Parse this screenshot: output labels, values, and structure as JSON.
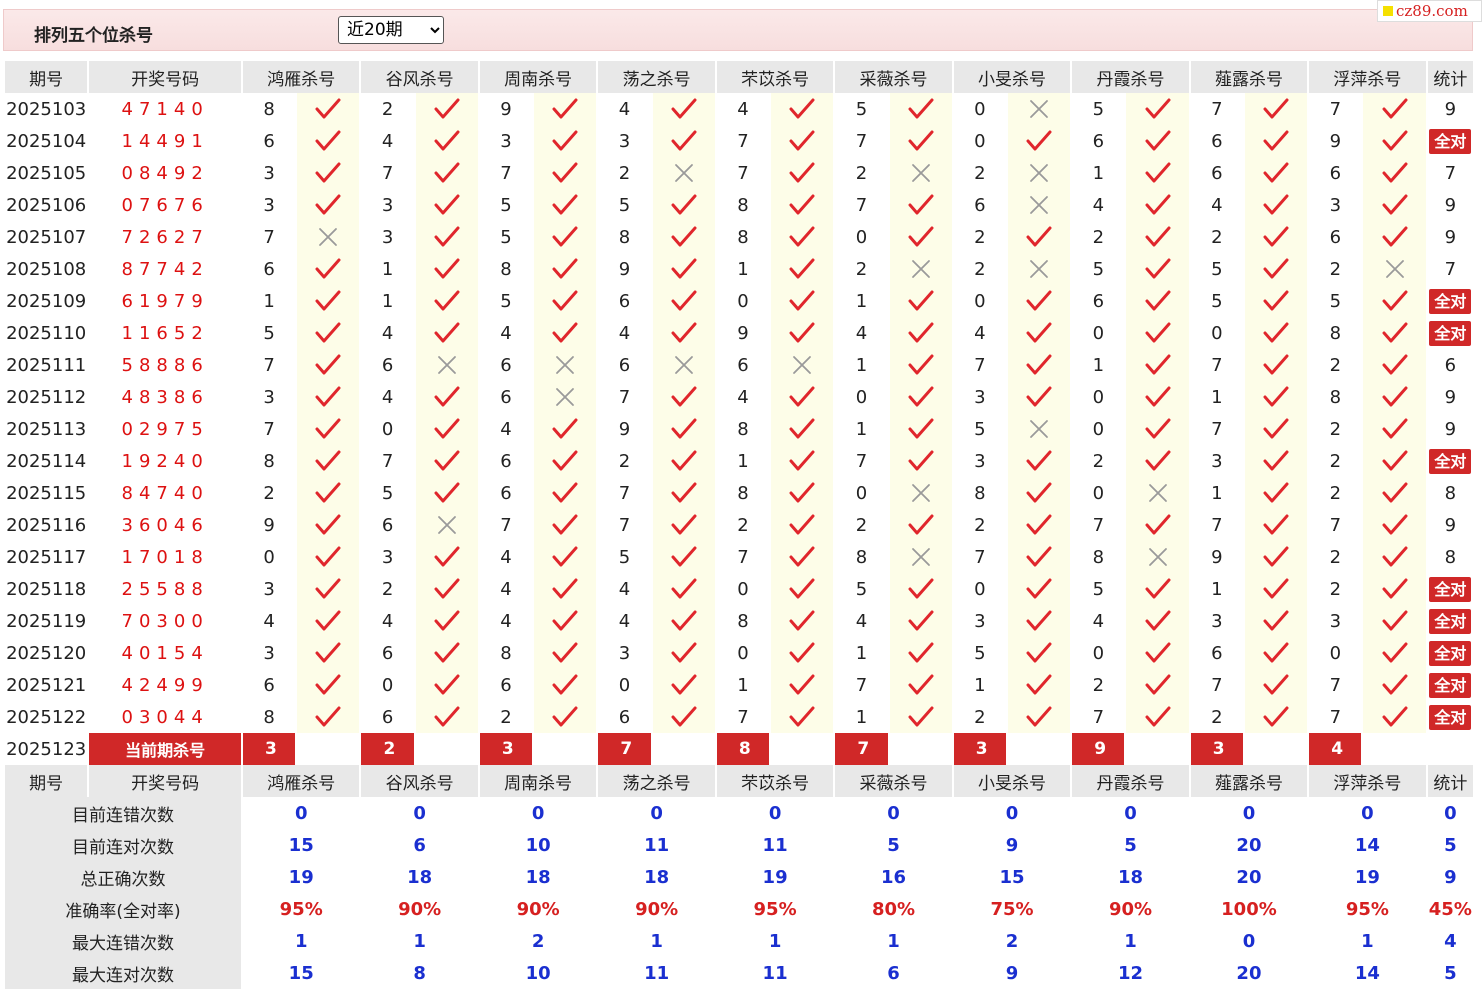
{
  "header": {
    "title": "排列五个位杀号",
    "range_select": "近20期",
    "range_options": [
      "近20期"
    ],
    "brand": "cz89.com"
  },
  "columns": {
    "period": "期号",
    "draw": "开奖号码",
    "experts": [
      "鸿雁杀号",
      "谷风杀号",
      "周南杀号",
      "荡之杀号",
      "芣苡杀号",
      "采薇杀号",
      "小旻杀号",
      "丹霞杀号",
      "薤露杀号",
      "浮萍杀号"
    ],
    "stat": "统计"
  },
  "marks": {
    "right": "✓",
    "wrong": "✗"
  },
  "all_right_label": "全对",
  "rows": [
    {
      "period": "2025103",
      "draw": "47140",
      "kills": [
        8,
        2,
        9,
        4,
        4,
        5,
        0,
        5,
        7,
        7
      ],
      "ok": [
        1,
        1,
        1,
        1,
        1,
        1,
        0,
        1,
        1,
        1
      ],
      "stat": "9"
    },
    {
      "period": "2025104",
      "draw": "14491",
      "kills": [
        6,
        4,
        3,
        3,
        7,
        7,
        0,
        6,
        6,
        9
      ],
      "ok": [
        1,
        1,
        1,
        1,
        1,
        1,
        1,
        1,
        1,
        1
      ],
      "stat": "全对"
    },
    {
      "period": "2025105",
      "draw": "08492",
      "kills": [
        3,
        7,
        7,
        2,
        7,
        2,
        2,
        1,
        6,
        6
      ],
      "ok": [
        1,
        1,
        1,
        0,
        1,
        0,
        0,
        1,
        1,
        1
      ],
      "stat": "7"
    },
    {
      "period": "2025106",
      "draw": "07676",
      "kills": [
        3,
        3,
        5,
        5,
        8,
        7,
        6,
        4,
        4,
        3
      ],
      "ok": [
        1,
        1,
        1,
        1,
        1,
        1,
        0,
        1,
        1,
        1
      ],
      "stat": "9"
    },
    {
      "period": "2025107",
      "draw": "72627",
      "kills": [
        7,
        3,
        5,
        8,
        8,
        0,
        2,
        2,
        2,
        6
      ],
      "ok": [
        0,
        1,
        1,
        1,
        1,
        1,
        1,
        1,
        1,
        1
      ],
      "stat": "9"
    },
    {
      "period": "2025108",
      "draw": "87742",
      "kills": [
        6,
        1,
        8,
        9,
        1,
        2,
        2,
        5,
        5,
        2
      ],
      "ok": [
        1,
        1,
        1,
        1,
        1,
        0,
        0,
        1,
        1,
        0
      ],
      "stat": "7"
    },
    {
      "period": "2025109",
      "draw": "61979",
      "kills": [
        1,
        1,
        5,
        6,
        0,
        1,
        0,
        6,
        5,
        5
      ],
      "ok": [
        1,
        1,
        1,
        1,
        1,
        1,
        1,
        1,
        1,
        1
      ],
      "stat": "全对"
    },
    {
      "period": "2025110",
      "draw": "11652",
      "kills": [
        5,
        4,
        4,
        4,
        9,
        4,
        4,
        0,
        0,
        8
      ],
      "ok": [
        1,
        1,
        1,
        1,
        1,
        1,
        1,
        1,
        1,
        1
      ],
      "stat": "全对"
    },
    {
      "period": "2025111",
      "draw": "58886",
      "kills": [
        7,
        6,
        6,
        6,
        6,
        1,
        7,
        1,
        7,
        2
      ],
      "ok": [
        1,
        0,
        0,
        0,
        0,
        1,
        1,
        1,
        1,
        1
      ],
      "stat": "6"
    },
    {
      "period": "2025112",
      "draw": "48386",
      "kills": [
        3,
        4,
        6,
        7,
        4,
        0,
        3,
        0,
        1,
        8
      ],
      "ok": [
        1,
        1,
        0,
        1,
        1,
        1,
        1,
        1,
        1,
        1
      ],
      "stat": "9"
    },
    {
      "period": "2025113",
      "draw": "02975",
      "kills": [
        7,
        0,
        4,
        9,
        8,
        1,
        5,
        0,
        7,
        2
      ],
      "ok": [
        1,
        1,
        1,
        1,
        1,
        1,
        0,
        1,
        1,
        1
      ],
      "stat": "9"
    },
    {
      "period": "2025114",
      "draw": "19240",
      "kills": [
        8,
        7,
        6,
        2,
        1,
        7,
        3,
        2,
        3,
        2
      ],
      "ok": [
        1,
        1,
        1,
        1,
        1,
        1,
        1,
        1,
        1,
        1
      ],
      "stat": "全对"
    },
    {
      "period": "2025115",
      "draw": "84740",
      "kills": [
        2,
        5,
        6,
        7,
        8,
        0,
        8,
        0,
        1,
        2
      ],
      "ok": [
        1,
        1,
        1,
        1,
        1,
        0,
        1,
        0,
        1,
        1
      ],
      "stat": "8"
    },
    {
      "period": "2025116",
      "draw": "36046",
      "kills": [
        9,
        6,
        7,
        7,
        2,
        2,
        2,
        7,
        7,
        7
      ],
      "ok": [
        1,
        0,
        1,
        1,
        1,
        1,
        1,
        1,
        1,
        1
      ],
      "stat": "9"
    },
    {
      "period": "2025117",
      "draw": "17018",
      "kills": [
        0,
        3,
        4,
        5,
        7,
        8,
        7,
        8,
        9,
        2
      ],
      "ok": [
        1,
        1,
        1,
        1,
        1,
        0,
        1,
        0,
        1,
        1
      ],
      "stat": "8"
    },
    {
      "period": "2025118",
      "draw": "25588",
      "kills": [
        3,
        2,
        4,
        4,
        0,
        5,
        0,
        5,
        1,
        2
      ],
      "ok": [
        1,
        1,
        1,
        1,
        1,
        1,
        1,
        1,
        1,
        1
      ],
      "stat": "全对"
    },
    {
      "period": "2025119",
      "draw": "70300",
      "kills": [
        4,
        4,
        4,
        4,
        8,
        4,
        3,
        4,
        3,
        3
      ],
      "ok": [
        1,
        1,
        1,
        1,
        1,
        1,
        1,
        1,
        1,
        1
      ],
      "stat": "全对"
    },
    {
      "period": "2025120",
      "draw": "40154",
      "kills": [
        3,
        6,
        8,
        3,
        0,
        1,
        5,
        0,
        6,
        0
      ],
      "ok": [
        1,
        1,
        1,
        1,
        1,
        1,
        1,
        1,
        1,
        1
      ],
      "stat": "全对"
    },
    {
      "period": "2025121",
      "draw": "42499",
      "kills": [
        6,
        0,
        6,
        0,
        1,
        7,
        1,
        2,
        7,
        7
      ],
      "ok": [
        1,
        1,
        1,
        1,
        1,
        1,
        1,
        1,
        1,
        1
      ],
      "stat": "全对"
    },
    {
      "period": "2025122",
      "draw": "03044",
      "kills": [
        8,
        6,
        2,
        6,
        7,
        1,
        2,
        7,
        2,
        7
      ],
      "ok": [
        1,
        1,
        1,
        1,
        1,
        1,
        1,
        1,
        1,
        1
      ],
      "stat": "全对"
    }
  ],
  "current": {
    "period": "2025123",
    "label": "当前期杀号",
    "kills": [
      3,
      2,
      3,
      7,
      8,
      7,
      3,
      9,
      3,
      4
    ]
  },
  "stats": [
    {
      "label": "目前连错次数",
      "values": [
        "0",
        "0",
        "0",
        "0",
        "0",
        "0",
        "0",
        "0",
        "0",
        "0"
      ],
      "stat": "0",
      "kind": "count"
    },
    {
      "label": "目前连对次数",
      "values": [
        "15",
        "6",
        "10",
        "11",
        "11",
        "5",
        "9",
        "5",
        "20",
        "14"
      ],
      "stat": "5",
      "kind": "count"
    },
    {
      "label": "总正确次数",
      "values": [
        "19",
        "18",
        "18",
        "18",
        "19",
        "16",
        "15",
        "18",
        "20",
        "19"
      ],
      "stat": "9",
      "kind": "count"
    },
    {
      "label": "准确率(全对率)",
      "values": [
        "95%",
        "90%",
        "90%",
        "90%",
        "95%",
        "80%",
        "75%",
        "90%",
        "100%",
        "95%"
      ],
      "stat": "45%",
      "kind": "rate"
    },
    {
      "label": "最大连错次数",
      "values": [
        "1",
        "1",
        "2",
        "1",
        "1",
        "1",
        "2",
        "1",
        "0",
        "1"
      ],
      "stat": "4",
      "kind": "count"
    },
    {
      "label": "最大连对次数",
      "values": [
        "15",
        "8",
        "10",
        "11",
        "11",
        "6",
        "9",
        "12",
        "20",
        "14"
      ],
      "stat": "5",
      "kind": "count"
    }
  ]
}
